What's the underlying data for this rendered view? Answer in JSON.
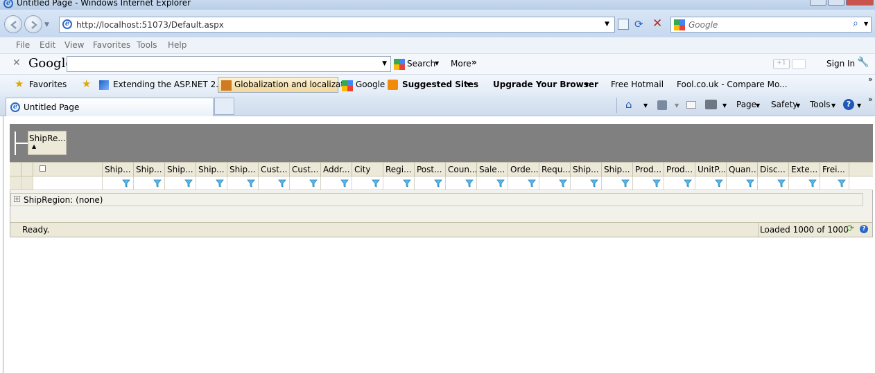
{
  "window": {
    "title": "Untitled Page - Windows Internet Explorer"
  },
  "address_bar": {
    "url": "http://localhost:51073/Default.aspx"
  },
  "search_box": {
    "placeholder": "Google"
  },
  "menu": [
    "File",
    "Edit",
    "View",
    "Favorites",
    "Tools",
    "Help"
  ],
  "google_toolbar": {
    "logo": "Google",
    "search_label": "Search",
    "more_label": "More",
    "plus_label": "+1",
    "sign_in_label": "Sign In"
  },
  "favorites_bar": {
    "favorites_label": "Favorites",
    "items": [
      "Extending the ASP.NET 2....",
      "Globalization and localizat...",
      "Google",
      "Suggested Sites",
      "Upgrade Your Browser",
      "Free Hotmail",
      "Fool.co.uk - Compare Mo..."
    ]
  },
  "tab": {
    "title": "Untitled Page"
  },
  "command_bar": {
    "page_label": "Page",
    "safety_label": "Safety",
    "tools_label": "Tools"
  },
  "grid": {
    "group_button_label": "ShipRe...",
    "columns": [
      "Ship...",
      "Ship...",
      "Ship...",
      "Ship...",
      "Ship...",
      "Cust...",
      "Cust...",
      "Addr...",
      "City",
      "Regi...",
      "Post...",
      "Coun...",
      "Sale...",
      "Orde...",
      "Requ...",
      "Ship...",
      "Ship...",
      "Prod...",
      "Prod...",
      "UnitP...",
      "Quan...",
      "Disc...",
      "Exte...",
      "Frei..."
    ],
    "group_row_label": "ShipRegion: (none)",
    "status_text": "Ready.",
    "loaded_text": "Loaded 1000 of 1000"
  },
  "colors": {
    "group_area": "#808080",
    "grid_header": "#ece9d8",
    "ie_chrome": "#d2e1f3"
  }
}
